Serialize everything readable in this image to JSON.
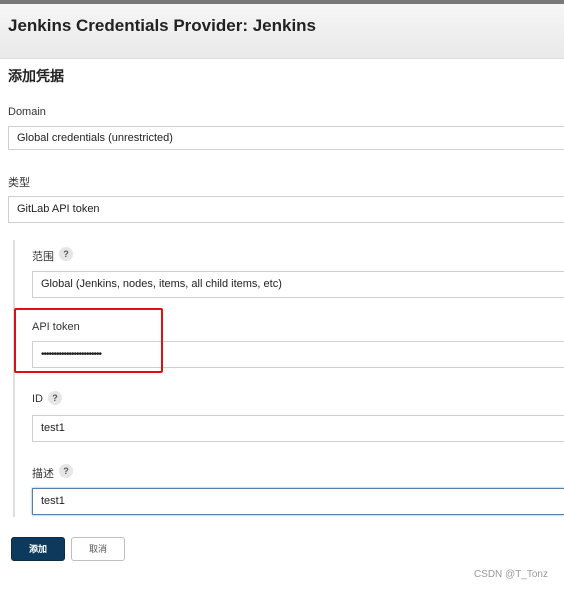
{
  "header": {
    "title": "Jenkins Credentials Provider: Jenkins"
  },
  "section_title": "添加凭据",
  "domain": {
    "label": "Domain",
    "value": "Global credentials (unrestricted)"
  },
  "kind": {
    "label": "类型",
    "value": "GitLab API token"
  },
  "scope": {
    "label": "范围",
    "help": "?",
    "value": "Global (Jenkins, nodes, items, all child items, etc)"
  },
  "api_token": {
    "label": "API token",
    "value": "••••••••••••••••••••••••"
  },
  "id_field": {
    "label": "ID",
    "help": "?",
    "value": "test1"
  },
  "description": {
    "label": "描述",
    "help": "?",
    "value": "test1"
  },
  "buttons": {
    "add": "添加",
    "cancel": "取消"
  },
  "watermark": "CSDN @T_Tonz",
  "colors": {
    "primary": "#0d3a5c",
    "highlight": "#e01010",
    "focus": "#5a7fa8"
  }
}
